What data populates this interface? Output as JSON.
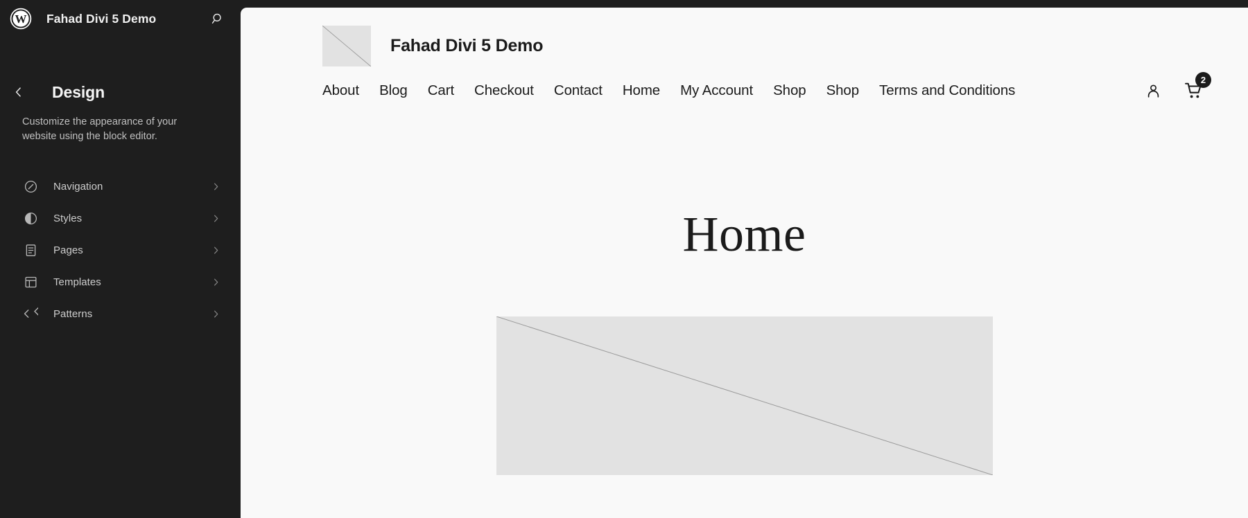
{
  "sidebar": {
    "site_name": "Fahad Divi 5 Demo",
    "logo_icon": "wordpress-logo",
    "search_icon": "search-icon",
    "back_icon": "chevron-left-icon",
    "panel_title": "Design",
    "panel_description": "Customize the appearance of your website using the block editor.",
    "items": [
      {
        "label": "Navigation",
        "icon": "compass-icon",
        "chevron": "chevron-right-icon"
      },
      {
        "label": "Styles",
        "icon": "contrast-half-circle-icon",
        "chevron": "chevron-right-icon"
      },
      {
        "label": "Pages",
        "icon": "page-lines-icon",
        "chevron": "chevron-right-icon"
      },
      {
        "label": "Templates",
        "icon": "layout-template-icon",
        "chevron": "chevron-right-icon"
      },
      {
        "label": "Patterns",
        "icon": "patterns-diamond-icon",
        "chevron": "chevron-right-icon"
      }
    ],
    "colors": {
      "background": "#1e1e1e",
      "text": "#cdcdcd",
      "title": "#f5f5f5"
    }
  },
  "canvas": {
    "background": "#f9f9f9",
    "site_header": {
      "logo_placeholder_icon": "image-placeholder-icon",
      "brand_title": "Fahad Divi 5 Demo",
      "nav_links": [
        "About",
        "Blog",
        "Cart",
        "Checkout",
        "Contact",
        "Home",
        "My Account",
        "Shop",
        "Shop",
        "Terms and Conditions"
      ],
      "account_icon": "user-account-icon",
      "cart_icon": "shopping-cart-icon",
      "cart_count": "2"
    },
    "page": {
      "title": "Home",
      "hero_placeholder_icon": "image-placeholder-icon"
    }
  }
}
